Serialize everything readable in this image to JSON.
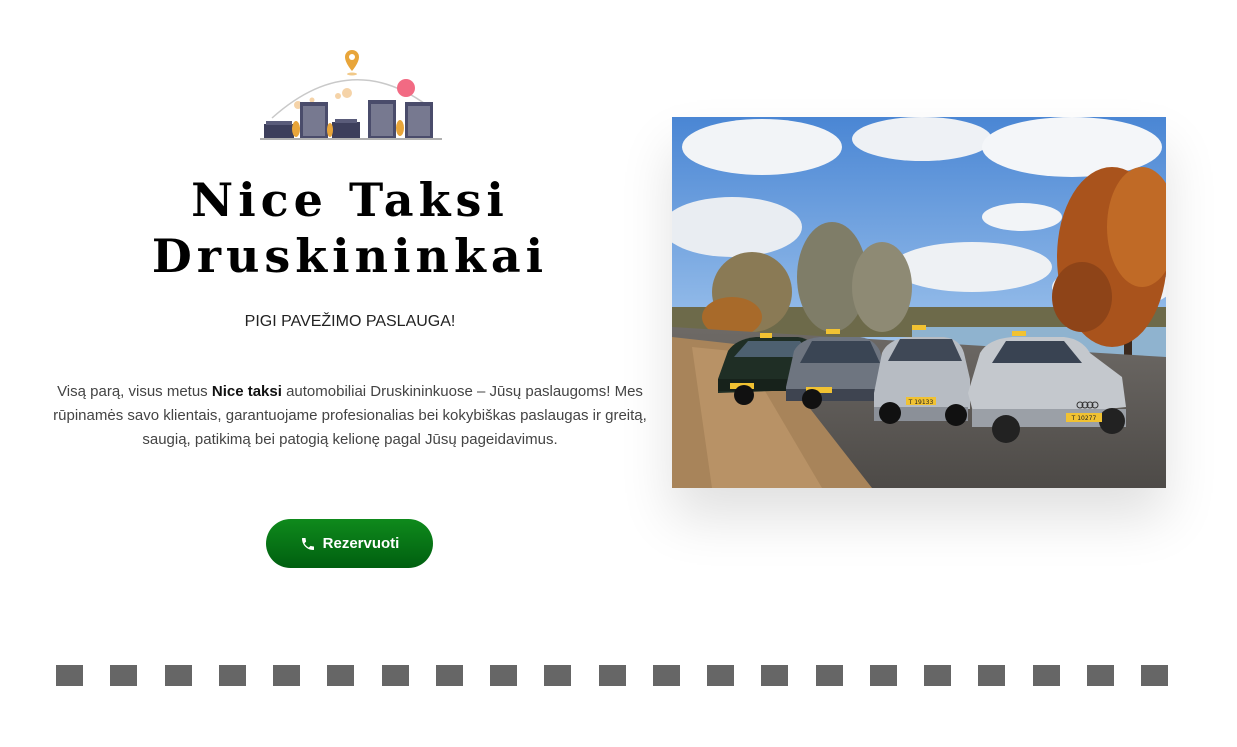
{
  "hero": {
    "title_line1": "Nice Taksi",
    "title_line2": "Druskininkai",
    "tagline": "PIGI PAVEŽIMO PASLAUGA!",
    "description_pre": "Visą parą, visus metus ",
    "description_bold": "Nice taksi",
    "description_post": " automobiliai Druskininkuose – Jūsų paslaugoms! Mes rūpinamės savo klientais, garantuojame profesionalias bei kokybiškas paslaugas ir greitą, saugią, patikimą bei patogią kelionę pagal Jūsų pageidavimus.",
    "button_label": "Rezervuoti",
    "button_icon": "phone-icon"
  },
  "image": {
    "plates": [
      "T 19133",
      "T 10277"
    ]
  },
  "divider": {
    "square_count": 21,
    "color": "#666666"
  },
  "colors": {
    "button_top": "#0f8a1c",
    "button_bottom": "#005f10",
    "logo_pin": "#e8a53a",
    "logo_accent": "#f26a83"
  }
}
